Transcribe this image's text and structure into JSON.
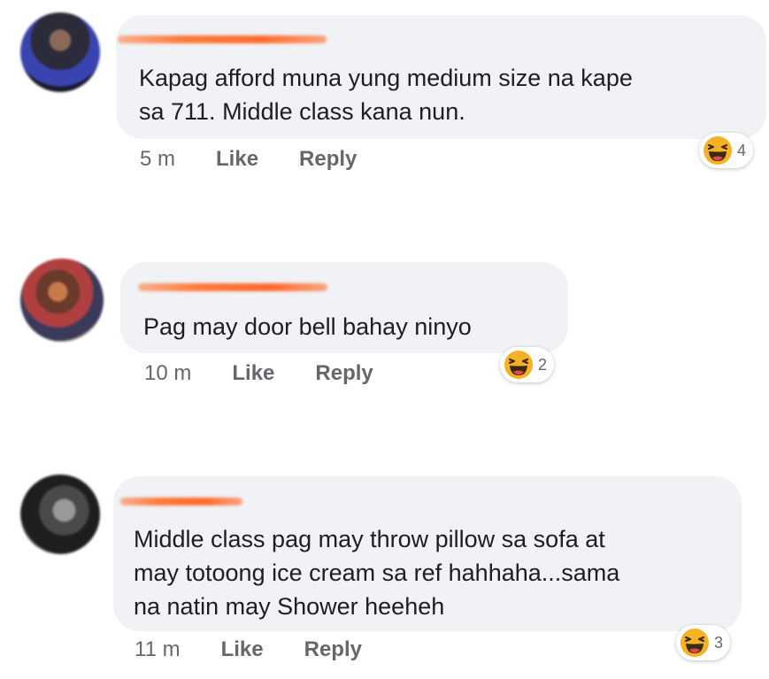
{
  "comments": [
    {
      "text": "Kapag afford muna yung medium size na kape\nsa 711. Middle class kana nun.",
      "time": "5 m",
      "like": "Like",
      "reply": "Reply",
      "reaction": {
        "icon": "laughing-emoji-icon",
        "count": "4"
      }
    },
    {
      "text": "Pag may door bell bahay ninyo",
      "time": "10 m",
      "like": "Like",
      "reply": "Reply",
      "reaction": {
        "icon": "laughing-emoji-icon",
        "count": "2"
      }
    },
    {
      "text": "Middle class pag may throw pillow sa sofa at\nmay totoong ice cream sa ref hahhaha...sama\nna natin may Shower heeheh",
      "time": "11 m",
      "like": "Like",
      "reply": "Reply",
      "reaction": {
        "icon": "laughing-emoji-icon",
        "count": "3"
      }
    }
  ],
  "colors": {
    "bubble": "#f0f2f5",
    "meta": "#65676b",
    "name_redaction": "#ff7a3d",
    "emoji": "#f7b125"
  }
}
